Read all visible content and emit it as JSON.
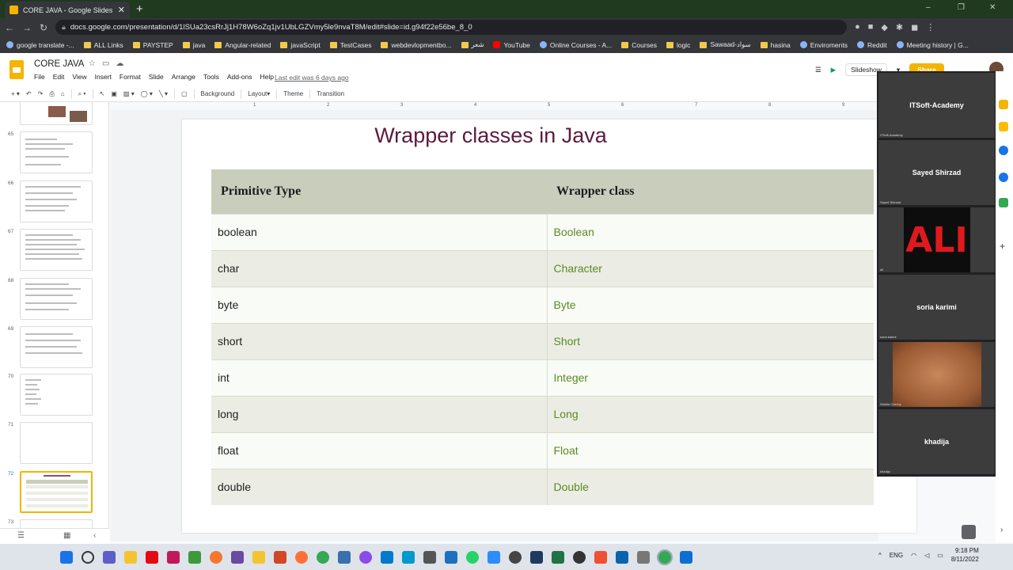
{
  "browser": {
    "tab_title": "CORE JAVA - Google Slides",
    "new_tab": "+",
    "close": "✕",
    "window_controls": [
      "–",
      "❐",
      "✕"
    ],
    "url": "docs.google.com/presentation/d/1lSUa23csRrJj1H78W6oZq1jv1UbLGZVmy5le9nvaT8M/edit#slide=id.g94f22e56be_8_0"
  },
  "bookmarks": [
    {
      "label": "google translate -...",
      "icon": "globe"
    },
    {
      "label": "ALL Links",
      "icon": "folder"
    },
    {
      "label": "PAYSTEP",
      "icon": "folder"
    },
    {
      "label": "java",
      "icon": "folder"
    },
    {
      "label": "Angular-related",
      "icon": "folder"
    },
    {
      "label": "javaScript",
      "icon": "folder"
    },
    {
      "label": "TestCases",
      "icon": "folder"
    },
    {
      "label": "webdevlopmentbo...",
      "icon": "folder"
    },
    {
      "label": "شعر",
      "icon": "folder"
    },
    {
      "label": "YouTube",
      "icon": "youtube"
    },
    {
      "label": "Online Courses - A...",
      "icon": "globe"
    },
    {
      "label": "Courses",
      "icon": "folder"
    },
    {
      "label": "logic",
      "icon": "folder"
    },
    {
      "label": "Sawaad-سواد",
      "icon": "folder"
    },
    {
      "label": "hasina",
      "icon": "folder"
    },
    {
      "label": "Enviroments",
      "icon": "globe"
    },
    {
      "label": "Reddit",
      "icon": "globe"
    },
    {
      "label": "Meeting history | G...",
      "icon": "globe"
    }
  ],
  "slides_app": {
    "doc_title": "CORE JAVA",
    "menu": [
      "File",
      "Edit",
      "View",
      "Insert",
      "Format",
      "Slide",
      "Arrange",
      "Tools",
      "Add-ons",
      "Help"
    ],
    "last_edit": "Last edit was 6 days ago",
    "slideshow_label": "Slideshow",
    "share_label": "Share",
    "toolbar": {
      "background": "Background",
      "layout": "Layout",
      "theme": "Theme",
      "transition": "Transition"
    },
    "ruler_ticks": [
      "1",
      "2",
      "3",
      "4",
      "5",
      "6",
      "7",
      "8",
      "9"
    ]
  },
  "filmstrip": {
    "numbers": [
      "65",
      "66",
      "67",
      "68",
      "69",
      "70",
      "71",
      "72",
      "73"
    ],
    "selected": "72"
  },
  "slide": {
    "title": "Wrapper classes in Java",
    "headers": [
      "Primitive Type",
      "Wrapper class"
    ],
    "rows": [
      [
        "boolean",
        "Boolean"
      ],
      [
        "char",
        "Character"
      ],
      [
        "byte",
        "Byte"
      ],
      [
        "short",
        "Short"
      ],
      [
        "int",
        "Integer"
      ],
      [
        "long",
        "Long"
      ],
      [
        "float",
        "Float"
      ],
      [
        "double",
        "Double"
      ]
    ]
  },
  "meeting": {
    "participants": [
      {
        "name": "ITSoft-Academy",
        "caption": "ITSoft-Academy"
      },
      {
        "name": "Sayed Shirzad",
        "caption": "Sayed Shirzad"
      },
      {
        "name": "",
        "caption": "ali",
        "image_text": "ALI"
      },
      {
        "name": "soria karimi",
        "caption": "soria karimi"
      },
      {
        "name": "",
        "caption": "Walida Chechy"
      },
      {
        "name": "khadija",
        "caption": "khadija"
      }
    ]
  },
  "taskbar": {
    "language": "ENG",
    "time": "9:18 PM",
    "date": "8/11/2022"
  },
  "colors": {
    "accent": "#f4b400",
    "title": "#5c1a3e",
    "wrapper_text": "#5a8a22",
    "header_bg": "#c9cebc"
  }
}
